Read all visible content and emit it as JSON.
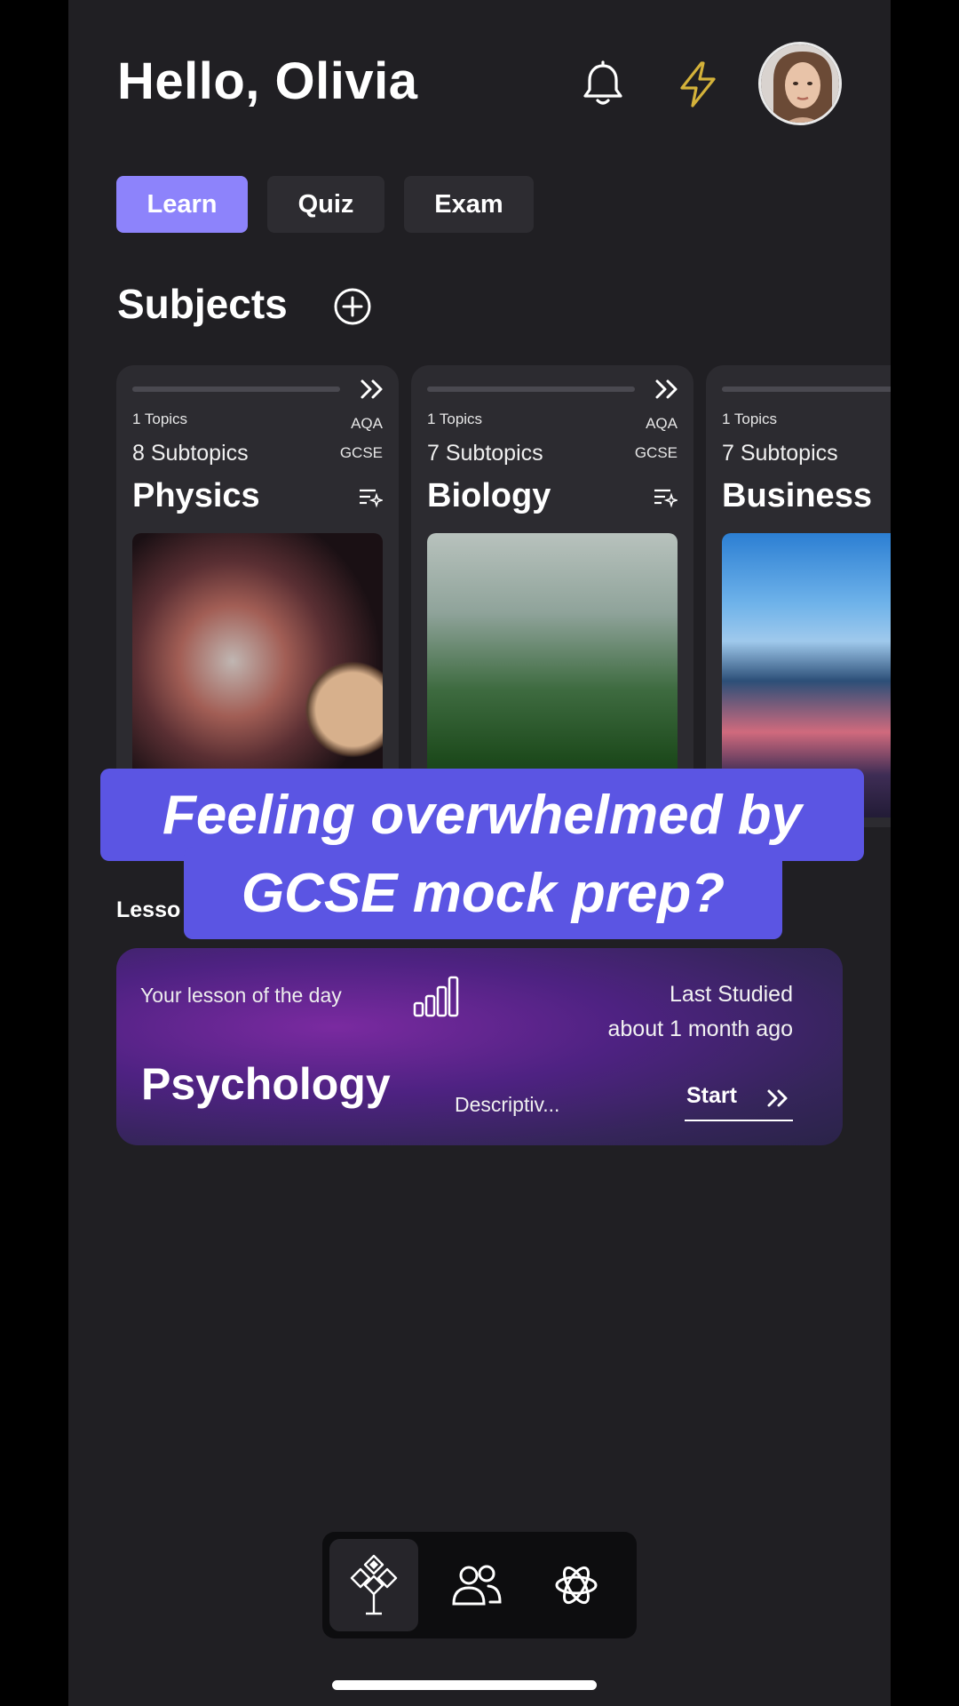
{
  "header": {
    "greeting": "Hello, Olivia"
  },
  "tabs": [
    {
      "label": "Learn",
      "active": true
    },
    {
      "label": "Quiz",
      "active": false
    },
    {
      "label": "Exam",
      "active": false
    }
  ],
  "subjects": {
    "title": "Subjects",
    "cards": [
      {
        "topics": "1 Topics",
        "board": "AQA",
        "subtopics": "8 Subtopics",
        "level": "GCSE",
        "name": "Physics"
      },
      {
        "topics": "1 Topics",
        "board": "AQA",
        "subtopics": "7 Subtopics",
        "level": "GCSE",
        "name": "Biology"
      },
      {
        "topics": "1 Topics",
        "board": "",
        "subtopics": "7 Subtopics",
        "level": "",
        "name": "Business"
      }
    ]
  },
  "caption": {
    "line1": "Feeling overwhelmed by",
    "line2": "GCSE mock prep?"
  },
  "lesson": {
    "section_label": "Lesso",
    "subtitle": "Your lesson of the day",
    "title": "Psychology",
    "description": "Descriptiv...",
    "last_studied": "Last Studied",
    "last_studied_when": "about 1 month ago",
    "start_label": "Start"
  },
  "colors": {
    "background": "#201f23",
    "accent": "#8d83fb",
    "caption_bg": "#5b55e3",
    "bolt": "#d4b23a"
  },
  "icons": {
    "notifications": "bell-icon",
    "streak": "lightning-icon",
    "add": "plus-circle-icon",
    "nav": [
      "tree-icon",
      "people-icon",
      "ai-knot-icon"
    ]
  }
}
